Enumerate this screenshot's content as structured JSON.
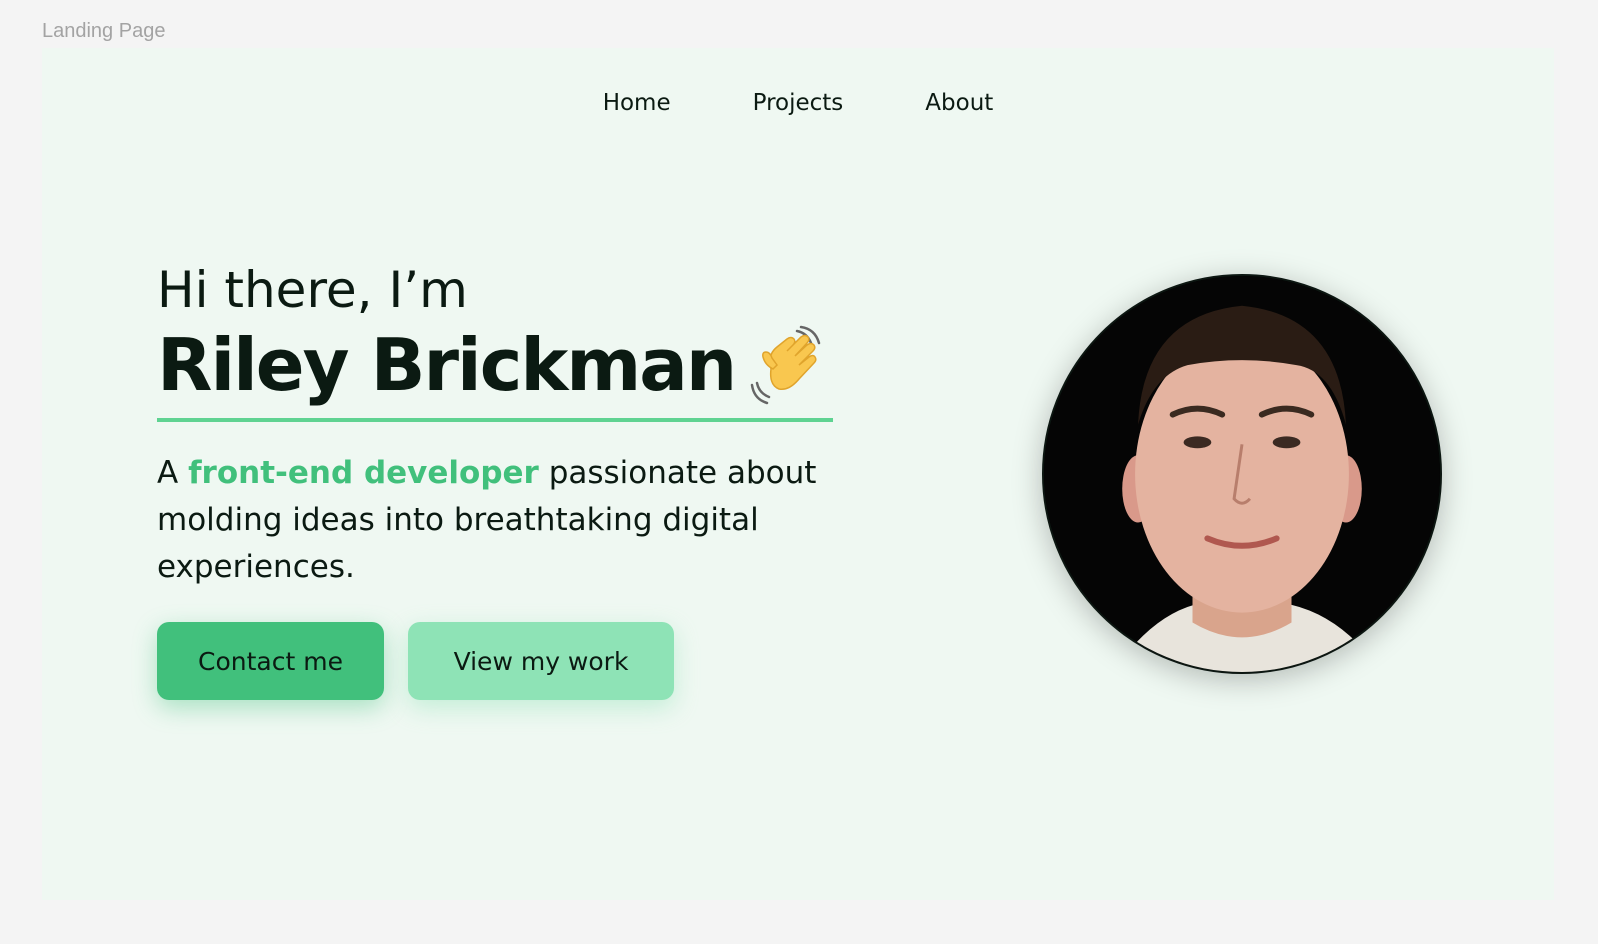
{
  "frame_label": "Landing Page",
  "nav": {
    "items": [
      "Home",
      "Projects",
      "About"
    ]
  },
  "hero": {
    "greeting": "Hi there, I’m",
    "name": "Riley Brickman",
    "wave_icon": "waving-hand-icon",
    "tagline_prefix": "A ",
    "tagline_highlight": "front-end developer",
    "tagline_suffix": " passionate about molding ideas into breathtaking digital experiences."
  },
  "buttons": {
    "contact": "Contact me",
    "view_work": "View my work"
  },
  "avatar": {
    "icon": "profile-photo"
  },
  "colors": {
    "page_bg": "#f4f4f4",
    "frame_bg": "#eff8f2",
    "accent": "#41c07c",
    "accent_light": "#8ee3b6",
    "underline": "#5fd392",
    "text": "#0b1a12"
  }
}
